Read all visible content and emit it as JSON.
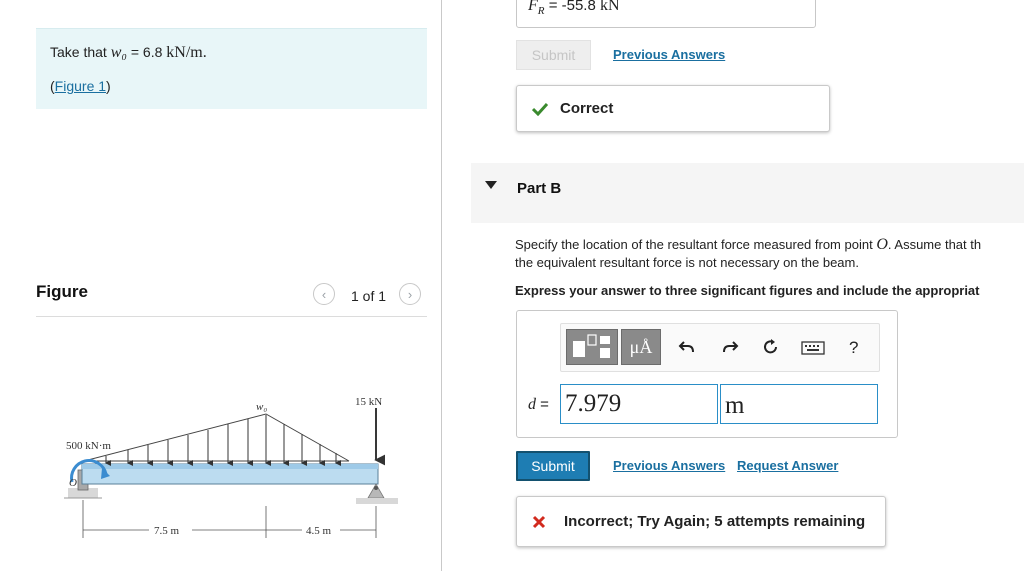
{
  "given": {
    "prefix": "Take that",
    "symbol": "w₀",
    "equals": "=",
    "value": "6.8",
    "unit": "kN/m",
    "period": "."
  },
  "figure_link": {
    "open": "(",
    "label": "Figure 1",
    "close": ")"
  },
  "figure_panel": {
    "title": "Figure",
    "pager": "1 of 1",
    "prev_icon": "‹",
    "next_icon": "›"
  },
  "figure_diagram": {
    "moment_label": "500 kN·m",
    "load_label": "w₀",
    "force_label": "15 kN",
    "origin_label": "O",
    "dim_left": "7.5 m",
    "dim_right": "4.5 m"
  },
  "part_a": {
    "symbol": "F",
    "subscript": "R",
    "equals": "=",
    "value": "-55.8",
    "unit": "kN",
    "submit_label": "Submit",
    "previous_answers_label": "Previous Answers",
    "status": "Correct",
    "status_color": "#3a8a2e"
  },
  "part_b": {
    "title": "Part B",
    "question_text_1": "Specify the location of the resultant force measured from point",
    "question_point": "O",
    "question_text_2": ". Assume that th",
    "question_line_2": "the equivalent resultant force is not necessary on the beam.",
    "instruction": "Express your answer to three significant figures and include the appropriat",
    "toolbar": {
      "mu_label": "μÅ",
      "undo_icon": "undo-icon",
      "redo_icon": "redo-icon",
      "reset_icon": "reset-icon",
      "keyboard_icon": "keyboard-icon",
      "help_label": "?"
    },
    "variable": "d",
    "equals": "=",
    "value": "7.979",
    "unit": "m",
    "submit_label": "Submit",
    "previous_answers_label": "Previous Answers",
    "request_answer_label": "Request Answer",
    "status": "Incorrect; Try Again; 5 attempts remaining",
    "status_color": "#d22a1e"
  }
}
